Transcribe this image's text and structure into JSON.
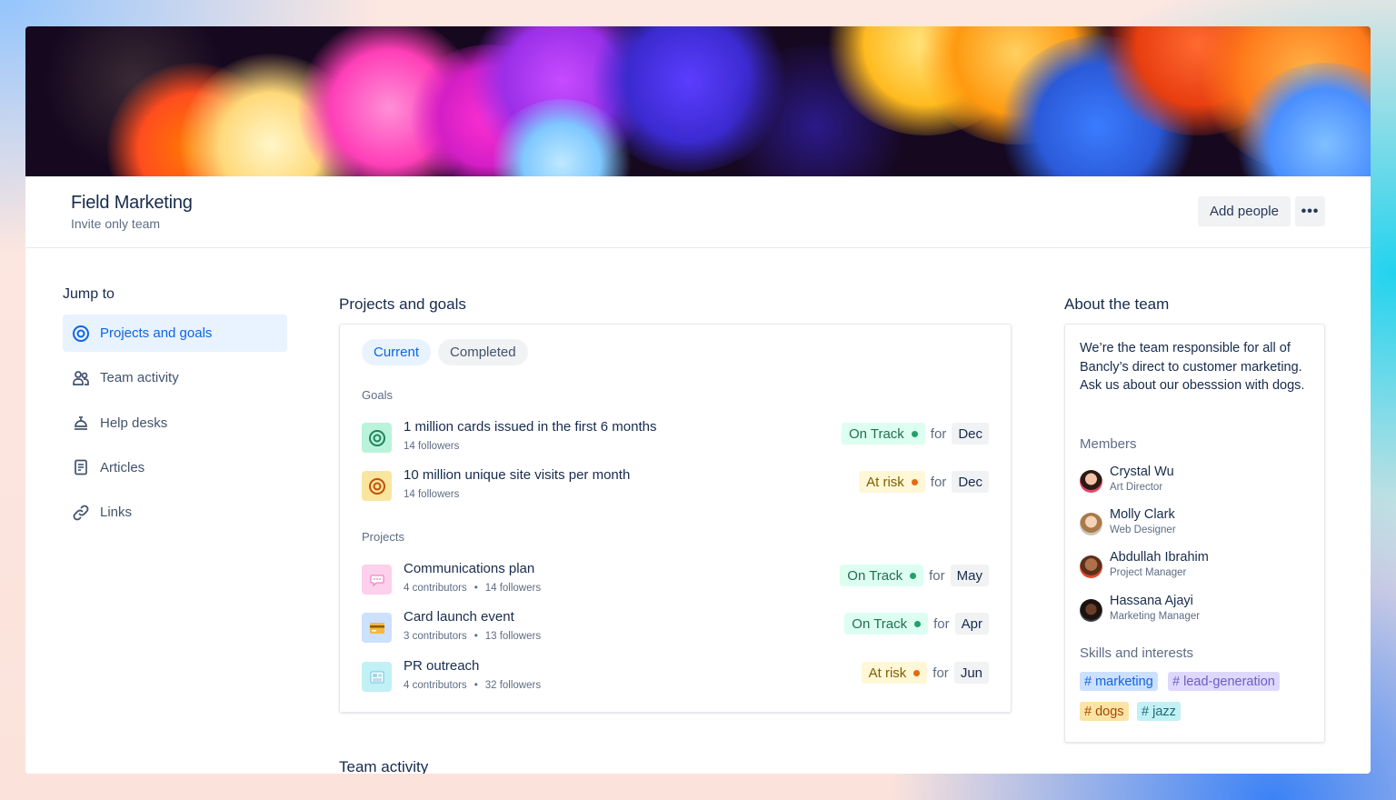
{
  "header": {
    "title": "Field Marketing",
    "subtitle": "Invite only team",
    "add_people": "Add people",
    "more": "•••"
  },
  "nav": {
    "title": "Jump to",
    "items": [
      {
        "label": "Projects and goals",
        "icon": "target-icon",
        "active": true
      },
      {
        "label": "Team activity",
        "icon": "people-icon",
        "active": false
      },
      {
        "label": "Help desks",
        "icon": "bell-icon",
        "active": false
      },
      {
        "label": "Articles",
        "icon": "document-icon",
        "active": false
      },
      {
        "label": "Links",
        "icon": "link-icon",
        "active": false
      }
    ]
  },
  "projects_section": {
    "title": "Projects and goals",
    "tabs": {
      "current": "Current",
      "completed": "Completed"
    },
    "goals_label": "Goals",
    "projects_label": "Projects",
    "goals": [
      {
        "title": "1 million cards issued in the first 6 months",
        "followers": "14 followers",
        "status": "On Track",
        "for": "for",
        "month": "Dec"
      },
      {
        "title": "10 million unique site visits per month",
        "followers": "14 followers",
        "status": "At risk",
        "for": "for",
        "month": "Dec"
      }
    ],
    "projects": [
      {
        "title": "Communications plan",
        "contributors": "4 contributors",
        "followers": "14 followers",
        "status": "On Track",
        "for": "for",
        "month": "May"
      },
      {
        "title": "Card launch event",
        "contributors": "3 contributors",
        "followers": "13 followers",
        "status": "On Track",
        "for": "for",
        "month": "Apr"
      },
      {
        "title": "PR outreach",
        "contributors": "4 contributors",
        "followers": "32 followers",
        "status": "At risk",
        "for": "for",
        "month": "Jun"
      }
    ],
    "dot_separator": "•"
  },
  "team_activity": {
    "title": "Team activity"
  },
  "about": {
    "title": "About the team",
    "description": "We’re the team responsible for all of Bancly’s direct to customer marketing. Ask us about our obesssion with dogs.",
    "members_label": "Members",
    "members": [
      {
        "name": "Crystal Wu",
        "role": "Art Director"
      },
      {
        "name": "Molly Clark",
        "role": "Web Designer"
      },
      {
        "name": "Abdullah Ibrahim",
        "role": "Project Manager"
      },
      {
        "name": "Hassana Ajayi",
        "role": "Marketing Manager"
      }
    ],
    "skills_label": "Skills and interests",
    "tags": [
      "# marketing",
      "# lead-generation",
      "# dogs",
      "# jazz"
    ]
  },
  "colors": {
    "accent": "#0c66e4",
    "on_track_bg": "#dcfff1",
    "on_track_dot": "#22a06b",
    "at_risk_bg": "#fff7d6",
    "at_risk_dot": "#e56910"
  }
}
